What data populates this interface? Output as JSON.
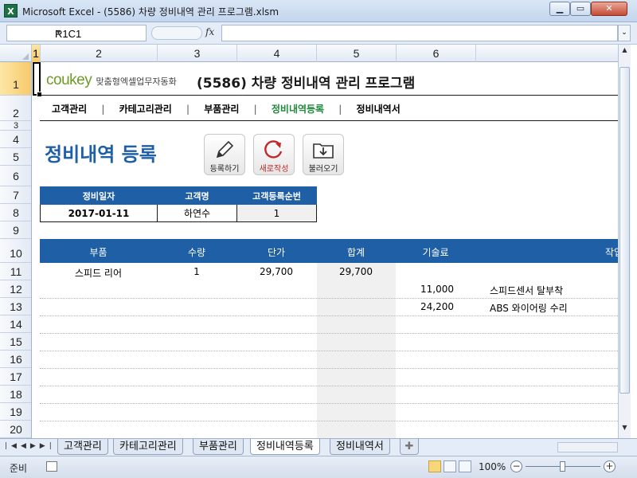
{
  "window": {
    "title": "Microsoft Excel - (5586) 차량 정비내역 관리 프로그램.xlsm",
    "app_icon": "X"
  },
  "formula_bar": {
    "name_box": "R1C1",
    "fx": "fx",
    "formula": ""
  },
  "columns": [
    "1",
    "2",
    "3",
    "4",
    "5",
    "6"
  ],
  "rows": [
    "1",
    "2",
    "3",
    "4",
    "5",
    "6",
    "7",
    "8",
    "9",
    "10",
    "11",
    "12",
    "13",
    "14",
    "15",
    "16",
    "17",
    "18",
    "19",
    "20"
  ],
  "header": {
    "brand": "coukey",
    "tagline": "맞춤형엑셀업무자동화",
    "title": "(5586) 차량 정비내역 관리 프로그램"
  },
  "menu": {
    "items": [
      "고객관리",
      "카테고리관리",
      "부품관리",
      "정비내역등록",
      "정비내역서"
    ],
    "separator": "|",
    "active_index": 3
  },
  "page_title": "정비내역 등록",
  "buttons": {
    "register": "등록하기",
    "new": "새로작성",
    "load": "불러오기"
  },
  "info_table": {
    "headers": [
      "정비일자",
      "고객명",
      "고객등록순번"
    ],
    "values": [
      "2017-01-11",
      "하연수",
      "1"
    ]
  },
  "detail_table": {
    "headers": [
      "부품",
      "수량",
      "단가",
      "합계",
      "기술료",
      "작업"
    ],
    "rows": [
      {
        "part": "스피드 리어",
        "qty": "1",
        "unit": "29,700",
        "sum": "29,700",
        "fee": "",
        "work": ""
      },
      {
        "part": "",
        "qty": "",
        "unit": "",
        "sum": "",
        "fee": "11,000",
        "work": "스피드센서 탈부착"
      },
      {
        "part": "",
        "qty": "",
        "unit": "",
        "sum": "",
        "fee": "24,200",
        "work": "ABS 와이어링 수리"
      }
    ]
  },
  "sheet_tabs": [
    "고객관리",
    "카테고리관리",
    "부품관리",
    "정비내역등록",
    "정비내역서"
  ],
  "active_tab": 3,
  "status": {
    "ready": "준비",
    "zoom": "100%"
  },
  "colors": {
    "accent": "#1f5fa6",
    "active_menu": "#1e8a3a",
    "brand": "#6f9a2a"
  }
}
